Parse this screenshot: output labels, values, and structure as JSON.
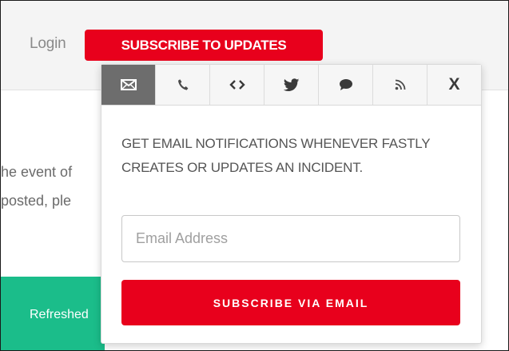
{
  "header": {
    "login_label": "Login",
    "subscribe_label": "SUBSCRIBE TO UPDATES"
  },
  "background": {
    "line1": "he event of",
    "line2": "posted, ple",
    "refresh_text": "Refreshed"
  },
  "popover": {
    "tabs": [
      {
        "icon": "envelope-icon",
        "active": true
      },
      {
        "icon": "phone-icon",
        "active": false
      },
      {
        "icon": "code-icon",
        "active": false
      },
      {
        "icon": "twitter-icon",
        "active": false
      },
      {
        "icon": "chat-bubble-icon",
        "active": false
      },
      {
        "icon": "rss-icon",
        "active": false
      },
      {
        "icon": "close-icon",
        "label": "X",
        "active": false
      }
    ],
    "description": "GET EMAIL NOTIFICATIONS WHENEVER FASTLY CREATES OR UPDATES AN INCIDENT.",
    "email_placeholder": "Email Address",
    "email_value": "",
    "submit_label": "SUBSCRIBE VIA EMAIL"
  },
  "colors": {
    "brand_red": "#e8001c",
    "active_tab": "#6d6d6d",
    "status_green": "#1bbd8a"
  }
}
